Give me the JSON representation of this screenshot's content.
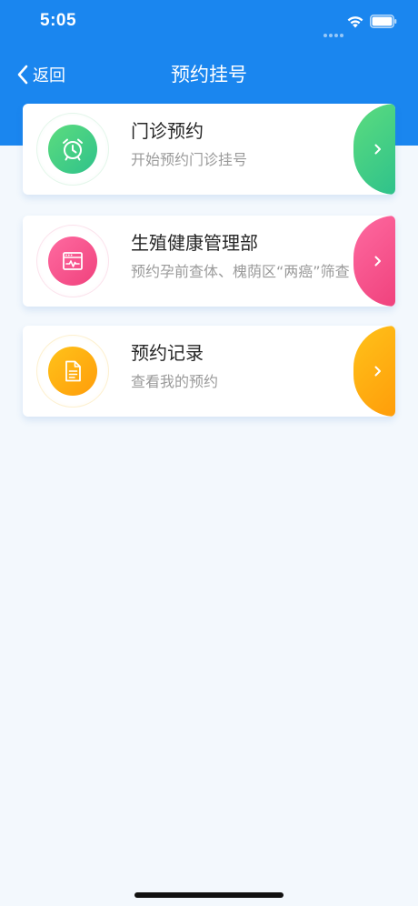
{
  "status_bar": {
    "time": "5:05"
  },
  "nav": {
    "back_label": "返回",
    "title": "预约挂号"
  },
  "cards": [
    {
      "title": "门诊预约",
      "subtitle": "开始预约门诊挂号",
      "icon": "alarm-clock-icon",
      "accent": "#3cc983"
    },
    {
      "title": "生殖健康管理部",
      "subtitle": "预约孕前查体、槐荫区“两癌”筛查",
      "icon": "browser-heartbeat-icon",
      "accent": "#f74f8a"
    },
    {
      "title": "预约记录",
      "subtitle": "查看我的预约",
      "icon": "document-icon",
      "accent": "#ffaf12"
    }
  ],
  "colors": {
    "header_blue": "#1a86ef",
    "page_background": "#f3f8fd"
  }
}
